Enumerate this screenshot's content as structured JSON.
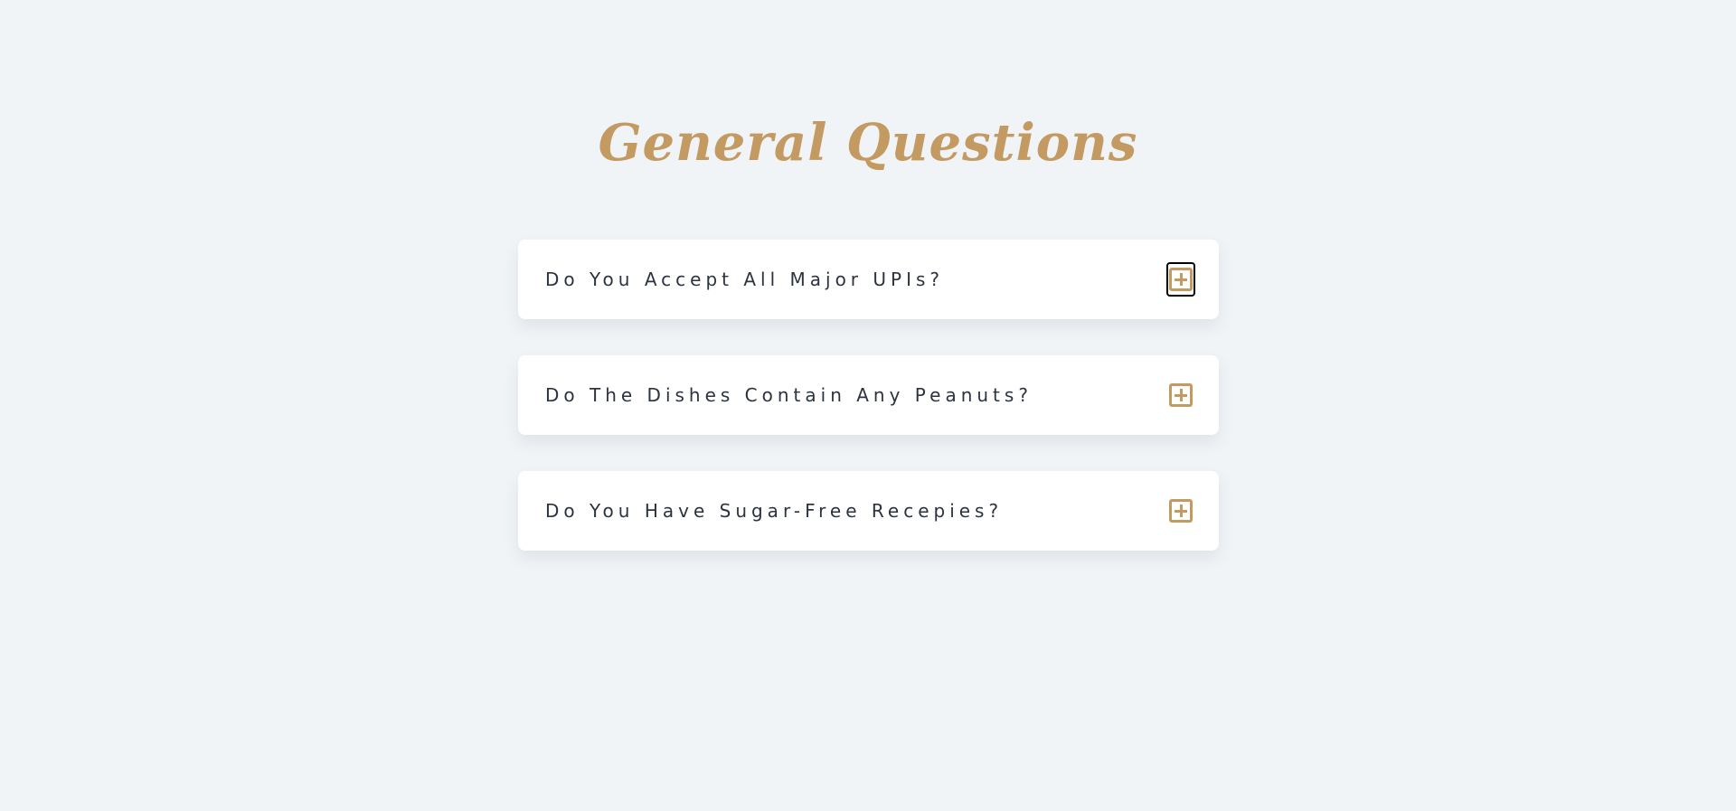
{
  "title": "General Questions",
  "colors": {
    "accent": "#c49a63",
    "background": "#f1f4f7",
    "card": "#ffffff",
    "question_text": "#2c3340"
  },
  "faq": [
    {
      "question": "Do You Accept All Major UPIs?",
      "icon": "plus-square-icon",
      "expanded": false,
      "focused": true
    },
    {
      "question": "Do The Dishes Contain Any Peanuts?",
      "icon": "plus-square-icon",
      "expanded": false,
      "focused": false
    },
    {
      "question": "Do You Have Sugar-Free Recepies?",
      "icon": "plus-square-icon",
      "expanded": false,
      "focused": false
    }
  ]
}
